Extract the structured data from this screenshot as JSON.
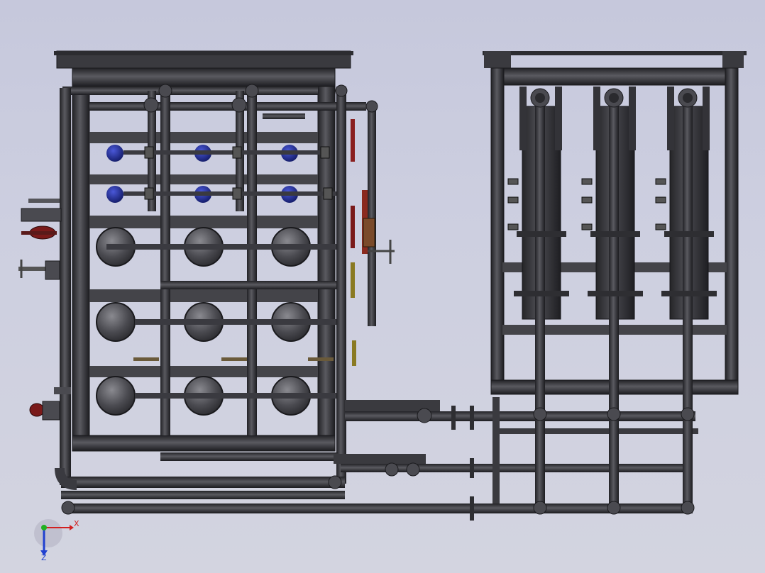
{
  "viewport": {
    "background_top": "#c6c8dc",
    "background_bottom": "#d3d4e0"
  },
  "model": {
    "pipe_color": "#3b3b40",
    "frame_color": "#3f3f44",
    "vessel_color": "#333338",
    "pump_motor_color": "#1f2a8a",
    "valve_red_color": "#8a1f1f",
    "valve_yellow_color": "#8a7a22"
  },
  "triad": {
    "x_label": "X",
    "z_label": "Z",
    "x_color": "#d22020",
    "y_color": "#20b020",
    "z_color": "#2040d0"
  }
}
